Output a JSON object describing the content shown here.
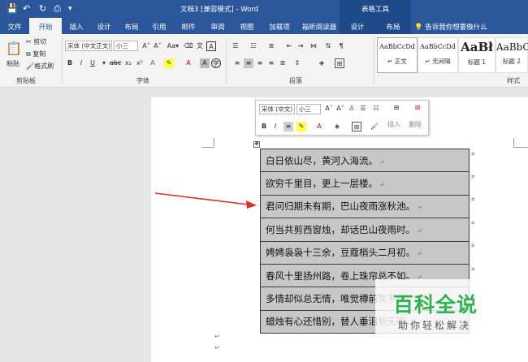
{
  "titlebar": {
    "title": "文档3 [兼容模式] - Word",
    "context_label": "表格工具"
  },
  "tabs": [
    {
      "label": "文件",
      "active": false
    },
    {
      "label": "开始",
      "active": true
    },
    {
      "label": "插入",
      "active": false
    },
    {
      "label": "设计",
      "active": false
    },
    {
      "label": "布局",
      "active": false
    },
    {
      "label": "引用",
      "active": false
    },
    {
      "label": "邮件",
      "active": false
    },
    {
      "label": "审阅",
      "active": false
    },
    {
      "label": "视图",
      "active": false
    },
    {
      "label": "加载项",
      "active": false
    },
    {
      "label": "福昕阅读器",
      "active": false
    },
    {
      "label": "设计",
      "active": false
    },
    {
      "label": "布局",
      "active": false
    }
  ],
  "tellme": "告诉我你想要做什么",
  "ribbon": {
    "clipboard": {
      "paste": "粘贴",
      "cut": "剪切",
      "copy": "复制",
      "format_painter": "格式刷",
      "label": "剪贴板"
    },
    "font": {
      "name": "宋体 (中文正文)",
      "size": "小三",
      "label": "字体"
    },
    "paragraph": {
      "label": "段落"
    },
    "styles": {
      "label": "样式",
      "items": [
        {
          "sample": "AaBbCcDd",
          "name": "↵ 正文"
        },
        {
          "sample": "AaBbCcDd",
          "name": "↵ 无间隔"
        },
        {
          "sample": "AaBł",
          "name": "标题 1"
        },
        {
          "sample": "AaBbC",
          "name": "标题 2"
        }
      ]
    }
  },
  "minitoolbar": {
    "font_name": "宋体 (中文)",
    "font_size": "小三",
    "insert": "插入",
    "delete": "删除"
  },
  "table": {
    "rows": [
      "白日依山尽，黄河入海流。",
      "欲穷千里目，更上一层楼。",
      "君问归期未有期，巴山夜雨涨秋池。",
      "何当共剪西窗烛，却话巴山夜雨时。",
      "娉娉袅袅十三余，豆蔻梢头二月初。",
      "春风十里扬州路，卷上珠帘总不如。",
      "多情却似总无情，唯觉樽前笑不成。",
      "蜡烛有心还惜别，替人垂泪到天明。"
    ],
    "para_mark": "↵",
    "cell_mark": "¤"
  },
  "watermark": {
    "main": "百科全说",
    "sub": "助你轻松解决"
  },
  "colors": {
    "brand": "#2b579a",
    "arrow": "#d9302c",
    "watermark_green": "#2fb24f"
  }
}
